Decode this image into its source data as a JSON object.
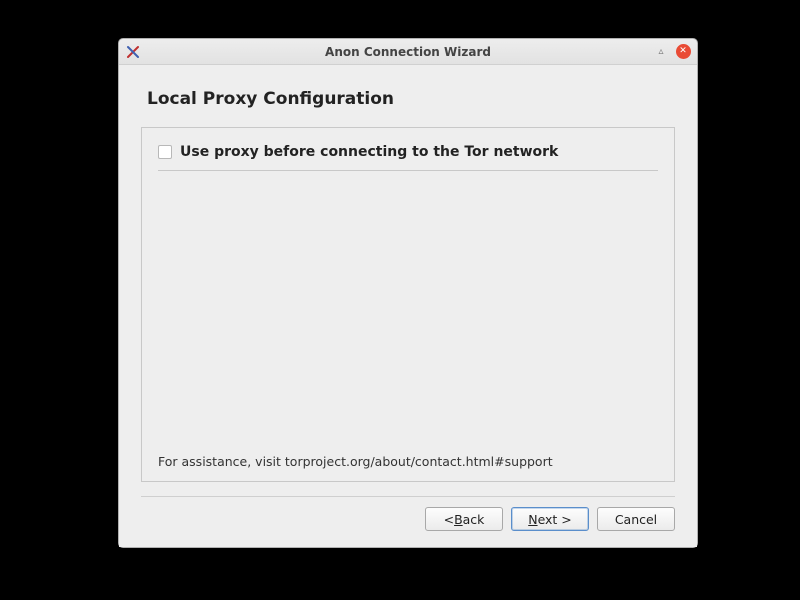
{
  "window": {
    "title": "Anon Connection Wizard"
  },
  "page": {
    "heading": "Local Proxy Configuration",
    "checkbox_label": "Use proxy before connecting to the Tor network",
    "checkbox_checked": false,
    "assistance": "For assistance, visit torproject.org/about/contact.html#support"
  },
  "buttons": {
    "back_prefix": "< ",
    "back_mn": "B",
    "back_suffix": "ack",
    "next_mn": "N",
    "next_suffix": "ext >",
    "cancel": "Cancel"
  }
}
